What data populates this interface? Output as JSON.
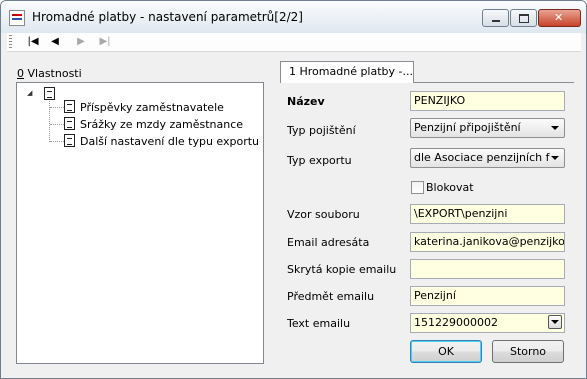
{
  "window": {
    "title": "Hromadné platby - nastavení parametrů[2/2]"
  },
  "toolbar": {
    "nav": [
      {
        "name": "first-record-button",
        "glyph": "|◀",
        "enabled": true
      },
      {
        "name": "previous-record-button",
        "glyph": "◀",
        "enabled": true
      },
      {
        "name": "next-record-button",
        "glyph": "▶",
        "enabled": false
      },
      {
        "name": "last-record-button",
        "glyph": "▶|",
        "enabled": false
      }
    ]
  },
  "properties": {
    "label_prefix": "0",
    "label_rest": " Vlastnosti",
    "tree": {
      "root_icon": "document-icon",
      "items": [
        {
          "label": "Příspěvky zaměstnavatele",
          "icon": "document-icon"
        },
        {
          "label": "Srážky ze mzdy zaměstnance",
          "icon": "document-icon"
        },
        {
          "label": "Další nastavení dle typu exportu",
          "icon": "document-icon"
        }
      ]
    }
  },
  "tab": {
    "label": "1 Hromadné platby -..."
  },
  "form": {
    "nazev": {
      "label": "Název",
      "value": "PENZIJKO"
    },
    "typ_pojisteni": {
      "label": "Typ pojištění",
      "value": "Penzijní připojištění"
    },
    "typ_exportu": {
      "label": "Typ exportu",
      "value": "dle Asociace penzijních fondů"
    },
    "blokovat": {
      "label": "Blokovat",
      "checked": false
    },
    "vzor_souboru": {
      "label": "Vzor souboru",
      "value": "\\EXPORT\\penzijni"
    },
    "email_adresata": {
      "label": "Email adresáta",
      "value": "katerina.janikova@penzijko.cz"
    },
    "skryta_kopie": {
      "label": "Skrytá kopie emailu",
      "value": ""
    },
    "predmet": {
      "label": "Předmět emailu",
      "value": "Penzijní"
    },
    "text_emailu": {
      "label": "Text emailu",
      "value": "151229000002"
    }
  },
  "buttons": {
    "ok": "OK",
    "cancel": "Storno"
  }
}
